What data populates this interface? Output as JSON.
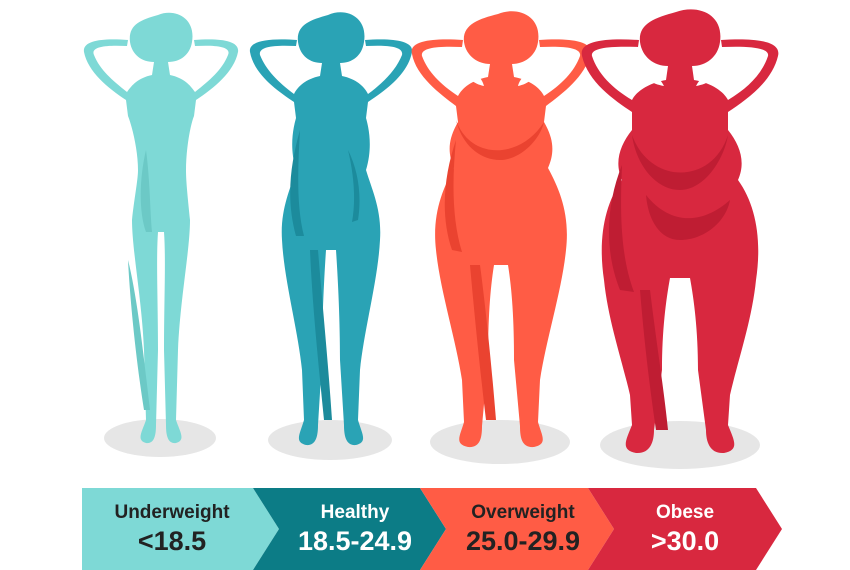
{
  "colors": {
    "underweight": "#7ed9d6",
    "underweight_shade": "#6cc9c6",
    "healthy": "#2aa3b5",
    "healthy_shade": "#1c8b9c",
    "healthy_band": "#0c7c86",
    "overweight": "#ff5c45",
    "overweight_shade": "#ea4330",
    "obese": "#d8283f",
    "obese_shade": "#bf1d33",
    "shadow": "#e6e6e6",
    "label_dark": "#222222",
    "label_light": "#ffffff"
  },
  "categories": [
    {
      "name": "Underweight",
      "range": "<18.5"
    },
    {
      "name": "Healthy",
      "range": "18.5-24.9"
    },
    {
      "name": "Overweight",
      "range": "25.0-29.9"
    },
    {
      "name": "Obese",
      "range": ">30.0"
    }
  ]
}
